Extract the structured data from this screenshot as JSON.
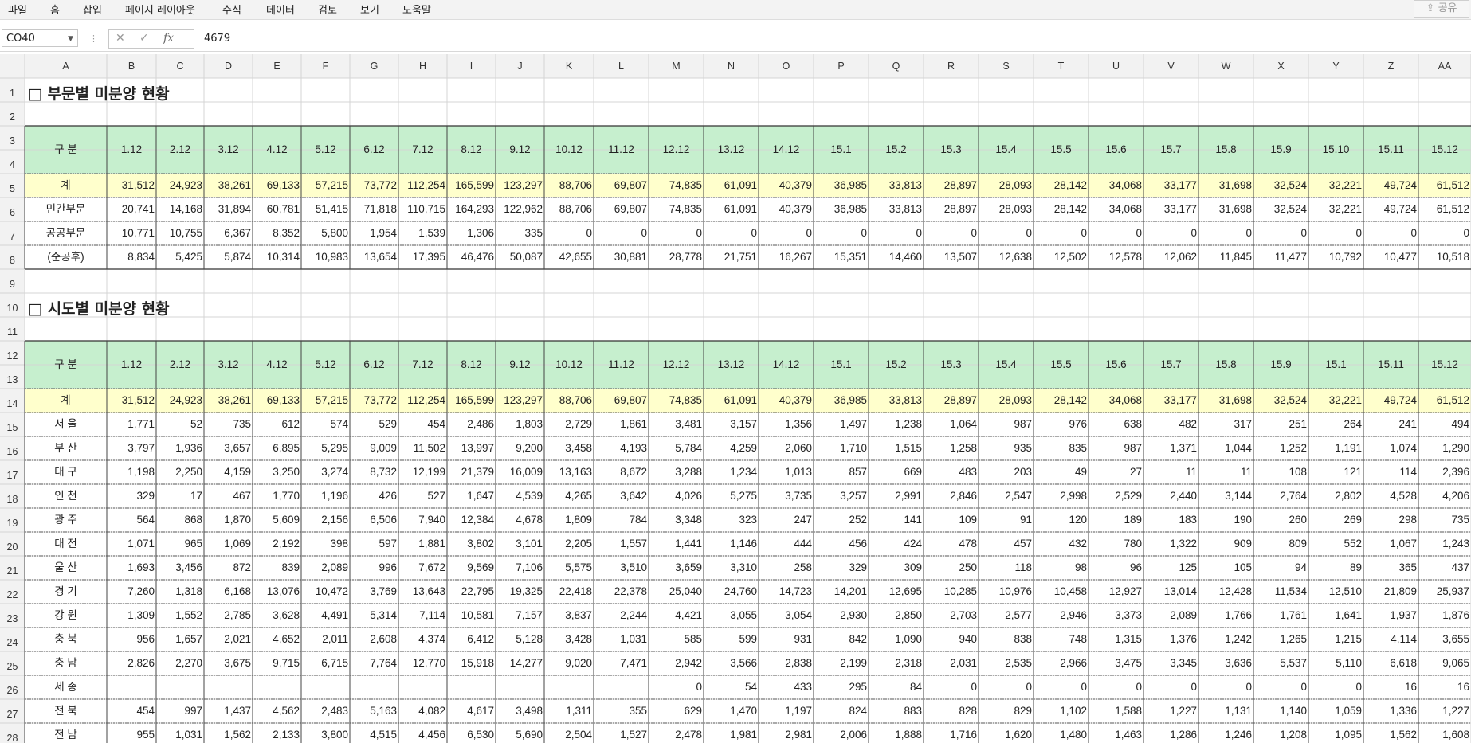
{
  "menu": {
    "items": [
      "파일",
      "홈",
      "삽입",
      "페이지 레이아웃",
      "수식",
      "데이터",
      "검토",
      "보기",
      "도움말"
    ],
    "share_label": "공유"
  },
  "formula_bar": {
    "name_box": "CO40",
    "value": "4679",
    "fx_label": "fx"
  },
  "columns": [
    "A",
    "B",
    "C",
    "D",
    "E",
    "F",
    "G",
    "H",
    "I",
    "J",
    "K",
    "L",
    "M",
    "N",
    "O",
    "P",
    "Q",
    "R",
    "S",
    "T",
    "U",
    "V",
    "W",
    "X",
    "Y",
    "Z",
    "AA"
  ],
  "rows": [
    "1",
    "2",
    "3",
    "4",
    "5",
    "6",
    "7",
    "8",
    "9",
    "10",
    "11",
    "12",
    "13",
    "14",
    "15",
    "16",
    "17",
    "18",
    "19",
    "20",
    "21",
    "22",
    "23",
    "24",
    "25",
    "26",
    "27",
    "28"
  ],
  "colors": {
    "header_green": "#c6efce",
    "total_yellow": "#ffffcc",
    "header_bg": "#f2f2f2",
    "gridline": "#d4d4d4"
  },
  "section1": {
    "title": "□ 부문별 미분양 현황",
    "header_label": "구 분",
    "periods": [
      "1.12",
      "2.12",
      "3.12",
      "4.12",
      "5.12",
      "6.12",
      "7.12",
      "8.12",
      "9.12",
      "10.12",
      "11.12",
      "12.12",
      "13.12",
      "14.12",
      "15.1",
      "15.2",
      "15.3",
      "15.4",
      "15.5",
      "15.6",
      "15.7",
      "15.8",
      "15.9",
      "15.10",
      "15.11",
      "15.12"
    ],
    "rows": [
      {
        "label": "계",
        "values": [
          "31,512",
          "24,923",
          "38,261",
          "69,133",
          "57,215",
          "73,772",
          "112,254",
          "165,599",
          "123,297",
          "88,706",
          "69,807",
          "74,835",
          "61,091",
          "40,379",
          "36,985",
          "33,813",
          "28,897",
          "28,093",
          "28,142",
          "34,068",
          "33,177",
          "31,698",
          "32,524",
          "32,221",
          "49,724",
          "61,512"
        ]
      },
      {
        "label": "민간부문",
        "values": [
          "20,741",
          "14,168",
          "31,894",
          "60,781",
          "51,415",
          "71,818",
          "110,715",
          "164,293",
          "122,962",
          "88,706",
          "69,807",
          "74,835",
          "61,091",
          "40,379",
          "36,985",
          "33,813",
          "28,897",
          "28,093",
          "28,142",
          "34,068",
          "33,177",
          "31,698",
          "32,524",
          "32,221",
          "49,724",
          "61,512"
        ]
      },
      {
        "label": "공공부문",
        "values": [
          "10,771",
          "10,755",
          "6,367",
          "8,352",
          "5,800",
          "1,954",
          "1,539",
          "1,306",
          "335",
          "0",
          "0",
          "0",
          "0",
          "0",
          "0",
          "0",
          "0",
          "0",
          "0",
          "0",
          "0",
          "0",
          "0",
          "0",
          "0",
          "0"
        ]
      },
      {
        "label": "(준공후)",
        "values": [
          "8,834",
          "5,425",
          "5,874",
          "10,314",
          "10,983",
          "13,654",
          "17,395",
          "46,476",
          "50,087",
          "42,655",
          "30,881",
          "28,778",
          "21,751",
          "16,267",
          "15,351",
          "14,460",
          "13,507",
          "12,638",
          "12,502",
          "12,578",
          "12,062",
          "11,845",
          "11,477",
          "10,792",
          "10,477",
          "10,518"
        ]
      }
    ]
  },
  "section2": {
    "title": "□ 시도별 미분양 현황",
    "header_label": "구 분",
    "periods": [
      "1.12",
      "2.12",
      "3.12",
      "4.12",
      "5.12",
      "6.12",
      "7.12",
      "8.12",
      "9.12",
      "10.12",
      "11.12",
      "12.12",
      "13.12",
      "14.12",
      "15.1",
      "15.2",
      "15.3",
      "15.4",
      "15.5",
      "15.6",
      "15.7",
      "15.8",
      "15.9",
      "15.1",
      "15.11",
      "15.12"
    ],
    "rows": [
      {
        "label": "계",
        "values": [
          "31,512",
          "24,923",
          "38,261",
          "69,133",
          "57,215",
          "73,772",
          "112,254",
          "165,599",
          "123,297",
          "88,706",
          "69,807",
          "74,835",
          "61,091",
          "40,379",
          "36,985",
          "33,813",
          "28,897",
          "28,093",
          "28,142",
          "34,068",
          "33,177",
          "31,698",
          "32,524",
          "32,221",
          "49,724",
          "61,512"
        ]
      },
      {
        "label": "서 울",
        "values": [
          "1,771",
          "52",
          "735",
          "612",
          "574",
          "529",
          "454",
          "2,486",
          "1,803",
          "2,729",
          "1,861",
          "3,481",
          "3,157",
          "1,356",
          "1,497",
          "1,238",
          "1,064",
          "987",
          "976",
          "638",
          "482",
          "317",
          "251",
          "264",
          "241",
          "494"
        ]
      },
      {
        "label": "부 산",
        "values": [
          "3,797",
          "1,936",
          "3,657",
          "6,895",
          "5,295",
          "9,009",
          "11,502",
          "13,997",
          "9,200",
          "3,458",
          "4,193",
          "5,784",
          "4,259",
          "2,060",
          "1,710",
          "1,515",
          "1,258",
          "935",
          "835",
          "987",
          "1,371",
          "1,044",
          "1,252",
          "1,191",
          "1,074",
          "1,290"
        ]
      },
      {
        "label": "대 구",
        "values": [
          "1,198",
          "2,250",
          "4,159",
          "3,250",
          "3,274",
          "8,732",
          "12,199",
          "21,379",
          "16,009",
          "13,163",
          "8,672",
          "3,288",
          "1,234",
          "1,013",
          "857",
          "669",
          "483",
          "203",
          "49",
          "27",
          "11",
          "11",
          "108",
          "121",
          "114",
          "2,396"
        ]
      },
      {
        "label": "인 천",
        "values": [
          "329",
          "17",
          "467",
          "1,770",
          "1,196",
          "426",
          "527",
          "1,647",
          "4,539",
          "4,265",
          "3,642",
          "4,026",
          "5,275",
          "3,735",
          "3,257",
          "2,991",
          "2,846",
          "2,547",
          "2,998",
          "2,529",
          "2,440",
          "3,144",
          "2,764",
          "2,802",
          "4,528",
          "4,206"
        ]
      },
      {
        "label": "광 주",
        "values": [
          "564",
          "868",
          "1,870",
          "5,609",
          "2,156",
          "6,506",
          "7,940",
          "12,384",
          "4,678",
          "1,809",
          "784",
          "3,348",
          "323",
          "247",
          "252",
          "141",
          "109",
          "91",
          "120",
          "189",
          "183",
          "190",
          "260",
          "269",
          "298",
          "735"
        ]
      },
      {
        "label": "대 전",
        "values": [
          "1,071",
          "965",
          "1,069",
          "2,192",
          "398",
          "597",
          "1,881",
          "3,802",
          "3,101",
          "2,205",
          "1,557",
          "1,441",
          "1,146",
          "444",
          "456",
          "424",
          "478",
          "457",
          "432",
          "780",
          "1,322",
          "909",
          "809",
          "552",
          "1,067",
          "1,243"
        ]
      },
      {
        "label": "울 산",
        "values": [
          "1,693",
          "3,456",
          "872",
          "839",
          "2,089",
          "996",
          "7,672",
          "9,569",
          "7,106",
          "5,575",
          "3,510",
          "3,659",
          "3,310",
          "258",
          "329",
          "309",
          "250",
          "118",
          "98",
          "96",
          "125",
          "105",
          "94",
          "89",
          "365",
          "437"
        ]
      },
      {
        "label": "경 기",
        "values": [
          "7,260",
          "1,318",
          "6,168",
          "13,076",
          "10,472",
          "3,769",
          "13,643",
          "22,795",
          "19,325",
          "22,418",
          "22,378",
          "25,040",
          "24,760",
          "14,723",
          "14,201",
          "12,695",
          "10,285",
          "10,976",
          "10,458",
          "12,927",
          "13,014",
          "12,428",
          "11,534",
          "12,510",
          "21,809",
          "25,937"
        ]
      },
      {
        "label": "강 원",
        "values": [
          "1,309",
          "1,552",
          "2,785",
          "3,628",
          "4,491",
          "5,314",
          "7,114",
          "10,581",
          "7,157",
          "3,837",
          "2,244",
          "4,421",
          "3,055",
          "3,054",
          "2,930",
          "2,850",
          "2,703",
          "2,577",
          "2,946",
          "3,373",
          "2,089",
          "1,766",
          "1,761",
          "1,641",
          "1,937",
          "1,876"
        ]
      },
      {
        "label": "충 북",
        "values": [
          "956",
          "1,657",
          "2,021",
          "4,652",
          "2,011",
          "2,608",
          "4,374",
          "6,412",
          "5,128",
          "3,428",
          "1,031",
          "585",
          "599",
          "931",
          "842",
          "1,090",
          "940",
          "838",
          "748",
          "1,315",
          "1,376",
          "1,242",
          "1,265",
          "1,215",
          "4,114",
          "3,655"
        ]
      },
      {
        "label": "충 남",
        "values": [
          "2,826",
          "2,270",
          "3,675",
          "9,715",
          "6,715",
          "7,764",
          "12,770",
          "15,918",
          "14,277",
          "9,020",
          "7,471",
          "2,942",
          "3,566",
          "2,838",
          "2,199",
          "2,318",
          "2,031",
          "2,535",
          "2,966",
          "3,475",
          "3,345",
          "3,636",
          "5,537",
          "5,110",
          "6,618",
          "9,065"
        ]
      },
      {
        "label": "세 종",
        "values": [
          "",
          "",
          "",
          "",
          "",
          "",
          "",
          "",
          "",
          "",
          "",
          "0",
          "54",
          "433",
          "295",
          "84",
          "0",
          "0",
          "0",
          "0",
          "0",
          "0",
          "0",
          "0",
          "16",
          "16"
        ]
      },
      {
        "label": "전 북",
        "values": [
          "454",
          "997",
          "1,437",
          "4,562",
          "2,483",
          "5,163",
          "4,082",
          "4,617",
          "3,498",
          "1,311",
          "355",
          "629",
          "1,470",
          "1,197",
          "824",
          "883",
          "828",
          "829",
          "1,102",
          "1,588",
          "1,227",
          "1,131",
          "1,140",
          "1,059",
          "1,336",
          "1,227"
        ]
      },
      {
        "label": "전 남",
        "values": [
          "955",
          "1,031",
          "1,562",
          "2,133",
          "3,800",
          "4,515",
          "4,456",
          "6,530",
          "5,690",
          "2,504",
          "1,527",
          "2,478",
          "1,981",
          "2,981",
          "2,006",
          "1,888",
          "1,716",
          "1,620",
          "1,480",
          "1,463",
          "1,286",
          "1,246",
          "1,208",
          "1,095",
          "1,562",
          "1,608"
        ]
      }
    ]
  }
}
